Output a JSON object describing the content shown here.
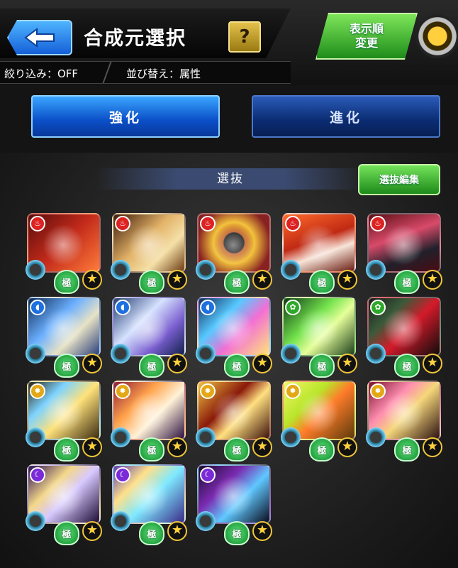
{
  "header": {
    "title": "合成元選択",
    "help_label": "?",
    "filter_label": "絞り込み：OFF",
    "sort_label": "並び替え：属性",
    "sort_order_button": [
      "表示順",
      "変更"
    ]
  },
  "tabs": [
    {
      "label": "強化",
      "active": true
    },
    {
      "label": "進化",
      "active": false
    }
  ],
  "section": {
    "label": "選抜",
    "edit_button": "選抜編集"
  },
  "colors": {
    "accent_blue": "#1e6fe0",
    "accent_green": "#2fa82a",
    "background": "#141414"
  },
  "cards": [
    {
      "element": "fire",
      "icon": "fire-icon",
      "badge": "極",
      "art": "red"
    },
    {
      "element": "fire",
      "icon": "fire-icon",
      "badge": "極",
      "art": "red2"
    },
    {
      "element": "fire",
      "icon": "fire-icon",
      "badge": "極",
      "art": "red3"
    },
    {
      "element": "fire",
      "icon": "fire-icon",
      "badge": "極",
      "art": "red4"
    },
    {
      "element": "fire",
      "icon": "fire-icon",
      "badge": "極",
      "art": "red5"
    },
    {
      "element": "water",
      "icon": "water-icon",
      "badge": "極",
      "art": "blue1"
    },
    {
      "element": "water",
      "icon": "water-icon",
      "badge": "極",
      "art": "blue2"
    },
    {
      "element": "water",
      "icon": "water-icon",
      "badge": "極",
      "art": "blue3"
    },
    {
      "element": "wood",
      "icon": "wood-icon",
      "badge": "極",
      "art": "green1"
    },
    {
      "element": "wood",
      "icon": "wood-icon",
      "badge": "極",
      "art": "green2"
    },
    {
      "element": "light",
      "icon": "light-icon",
      "badge": "極",
      "art": "gold1"
    },
    {
      "element": "light",
      "icon": "light-icon",
      "badge": "極",
      "art": "gold2"
    },
    {
      "element": "light",
      "icon": "light-icon",
      "badge": "極",
      "art": "gold3"
    },
    {
      "element": "light",
      "icon": "light-icon",
      "badge": "極",
      "art": "gold4"
    },
    {
      "element": "light",
      "icon": "light-icon",
      "badge": "極",
      "art": "gold5"
    },
    {
      "element": "dark",
      "icon": "dark-icon",
      "badge": "極",
      "art": "dark1"
    },
    {
      "element": "dark",
      "icon": "dark-icon",
      "badge": "極",
      "art": "dark2"
    },
    {
      "element": "dark",
      "icon": "dark-icon",
      "badge": "極",
      "art": "dark3"
    }
  ]
}
